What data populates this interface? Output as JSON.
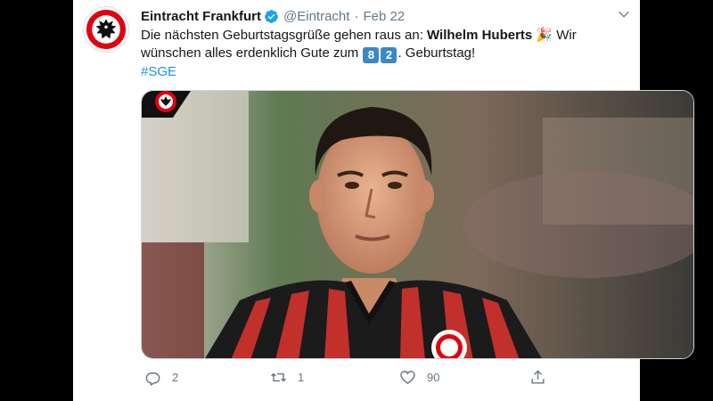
{
  "tweet": {
    "author_name": "Eintracht Frankfurt",
    "handle": "@Eintracht",
    "separator": "·",
    "date": "Feb 22",
    "text_part1": "Die nächsten Geburtstagsgrüße gehen raus an: ",
    "text_bold": "Wilhelm Huberts",
    "party_emoji": "🎉",
    "text_part2": " Wir wünschen alles erdenklich Gute zum ",
    "keycap_1": "8",
    "keycap_2": "2",
    "text_part3": ". Geburtstag!",
    "hashtag": "#SGE"
  },
  "actions": {
    "reply_count": "2",
    "retweet_count": "1",
    "like_count": "90",
    "icons": [
      "reply-icon",
      "retweet-icon",
      "like-icon",
      "share-icon"
    ]
  },
  "colors": {
    "brand_red": "#e1000f",
    "link_blue": "#1b95e0",
    "muted_gray": "#657786",
    "verified_blue": "#1da1f2"
  }
}
